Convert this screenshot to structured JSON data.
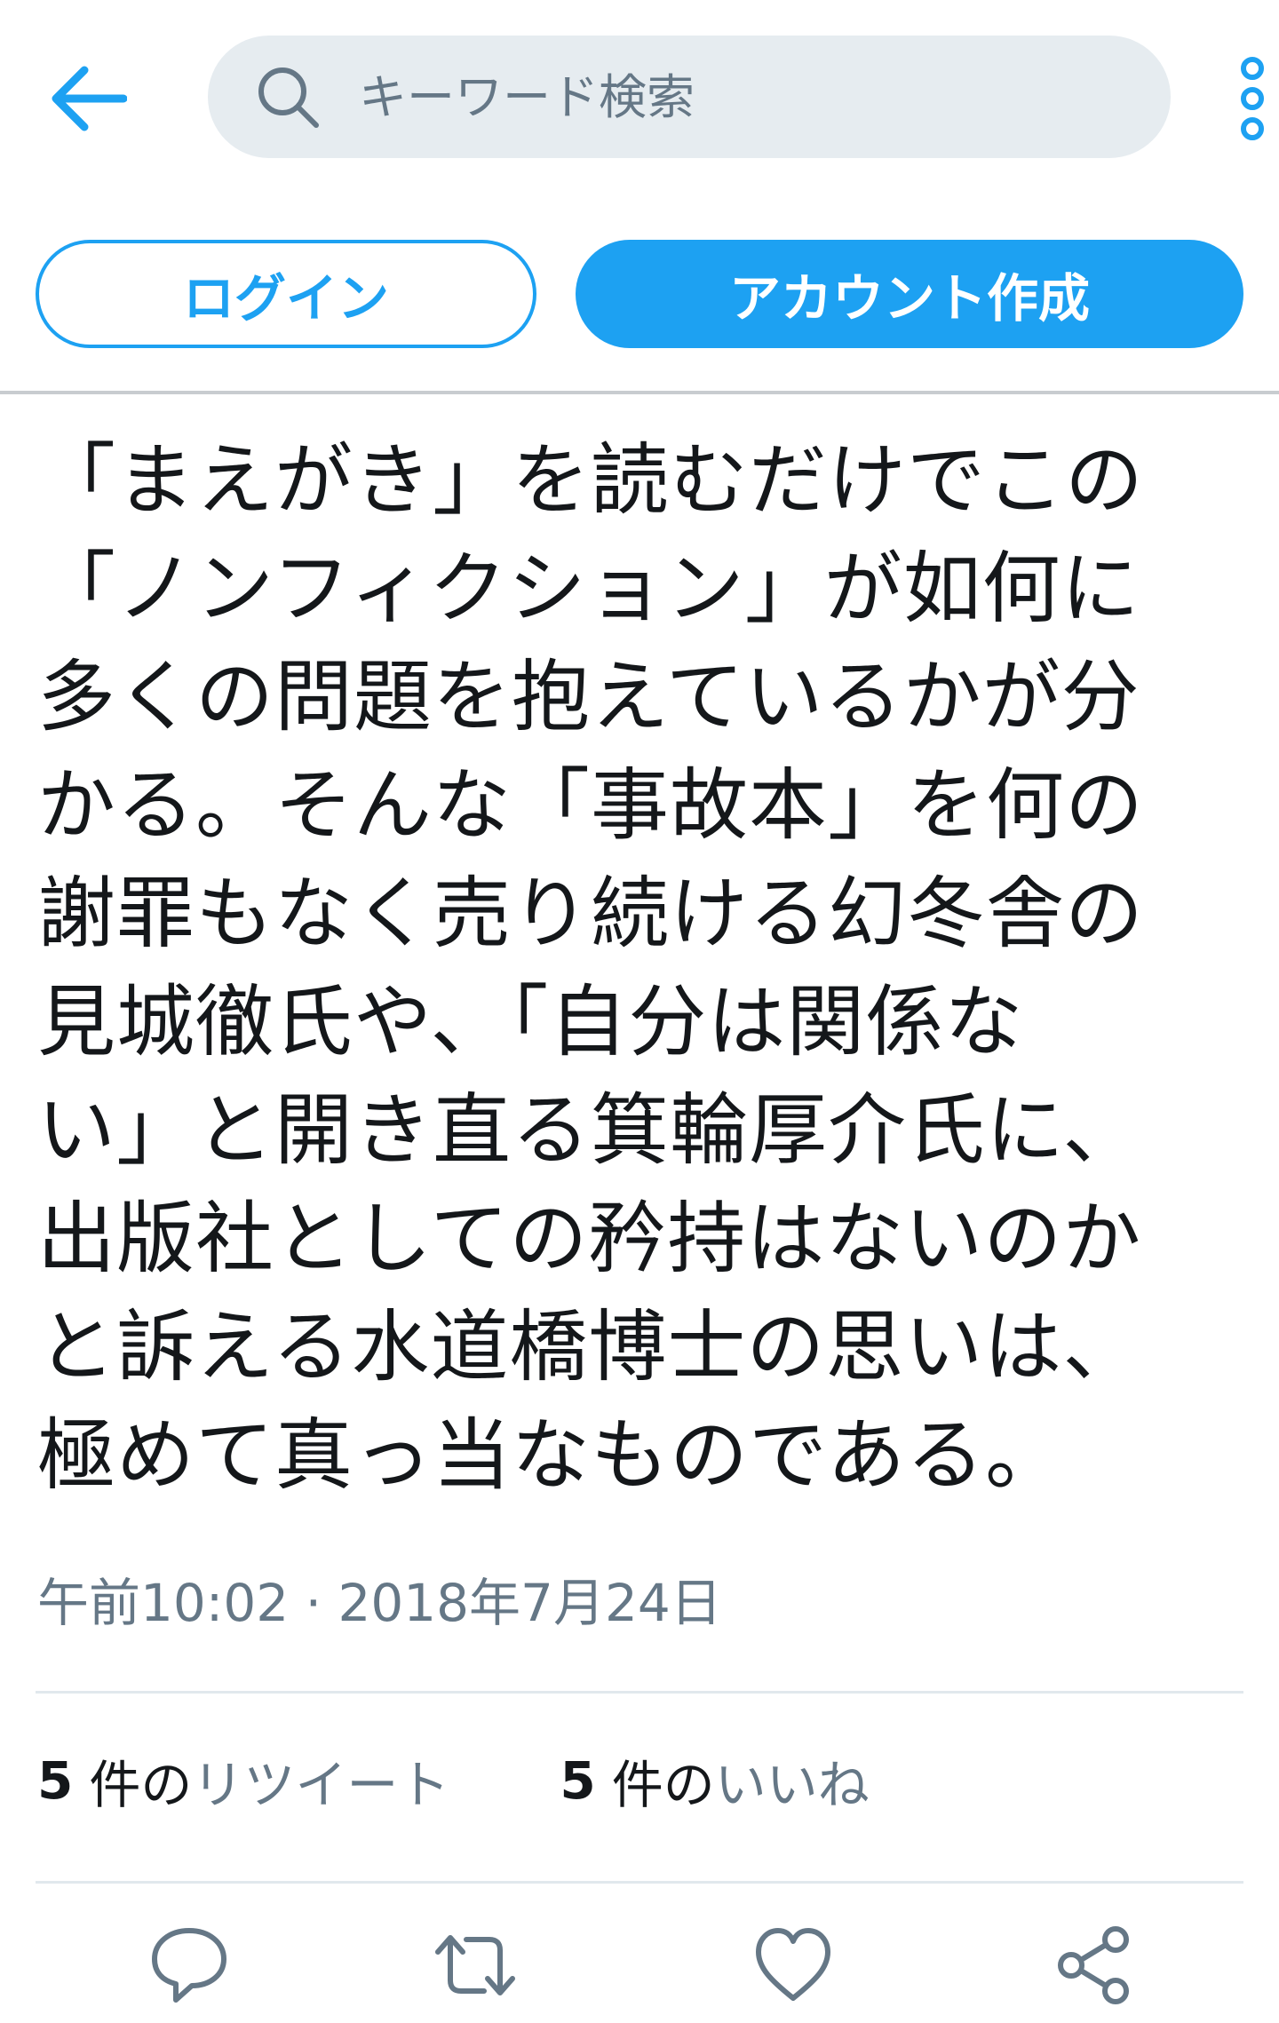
{
  "header": {
    "search_placeholder": "キーワード検索",
    "back_icon": "arrow-left-icon",
    "more_icon": "vertical-dots-icon"
  },
  "auth": {
    "login_label": "ログイン",
    "signup_label": "アカウント作成"
  },
  "tweet": {
    "text": "「まえがき」を読むだけでこの\n「ノンフィクション」が如何に\n多くの問題を抱えているかが分\nかる。そんな「事故本」を何の\n謝罪もなく売り続ける幻冬舎の\n見城徹氏や、「自分は関係な\nい」と開き直る箕輪厚介氏に、\n出版社としての矜持はないのか\nと訴える水道橋博士の思いは、\n極めて真っ当なものである。",
    "timestamp": "午前10:02 · 2018年7月24日"
  },
  "stats": {
    "retweet_count": "5",
    "retweet_unit": "件の",
    "retweet_label": "リツイート",
    "like_count": "5",
    "like_unit": "件の",
    "like_label": "いいね"
  },
  "actions": {
    "icons": [
      "reply-icon",
      "retweet-icon",
      "like-icon",
      "share-icon"
    ]
  },
  "colors": {
    "accent": "#1da1f2",
    "text": "#14171a",
    "muted": "#657786",
    "search_bg": "#e6ecf0",
    "divider": "#e1e8ed"
  }
}
